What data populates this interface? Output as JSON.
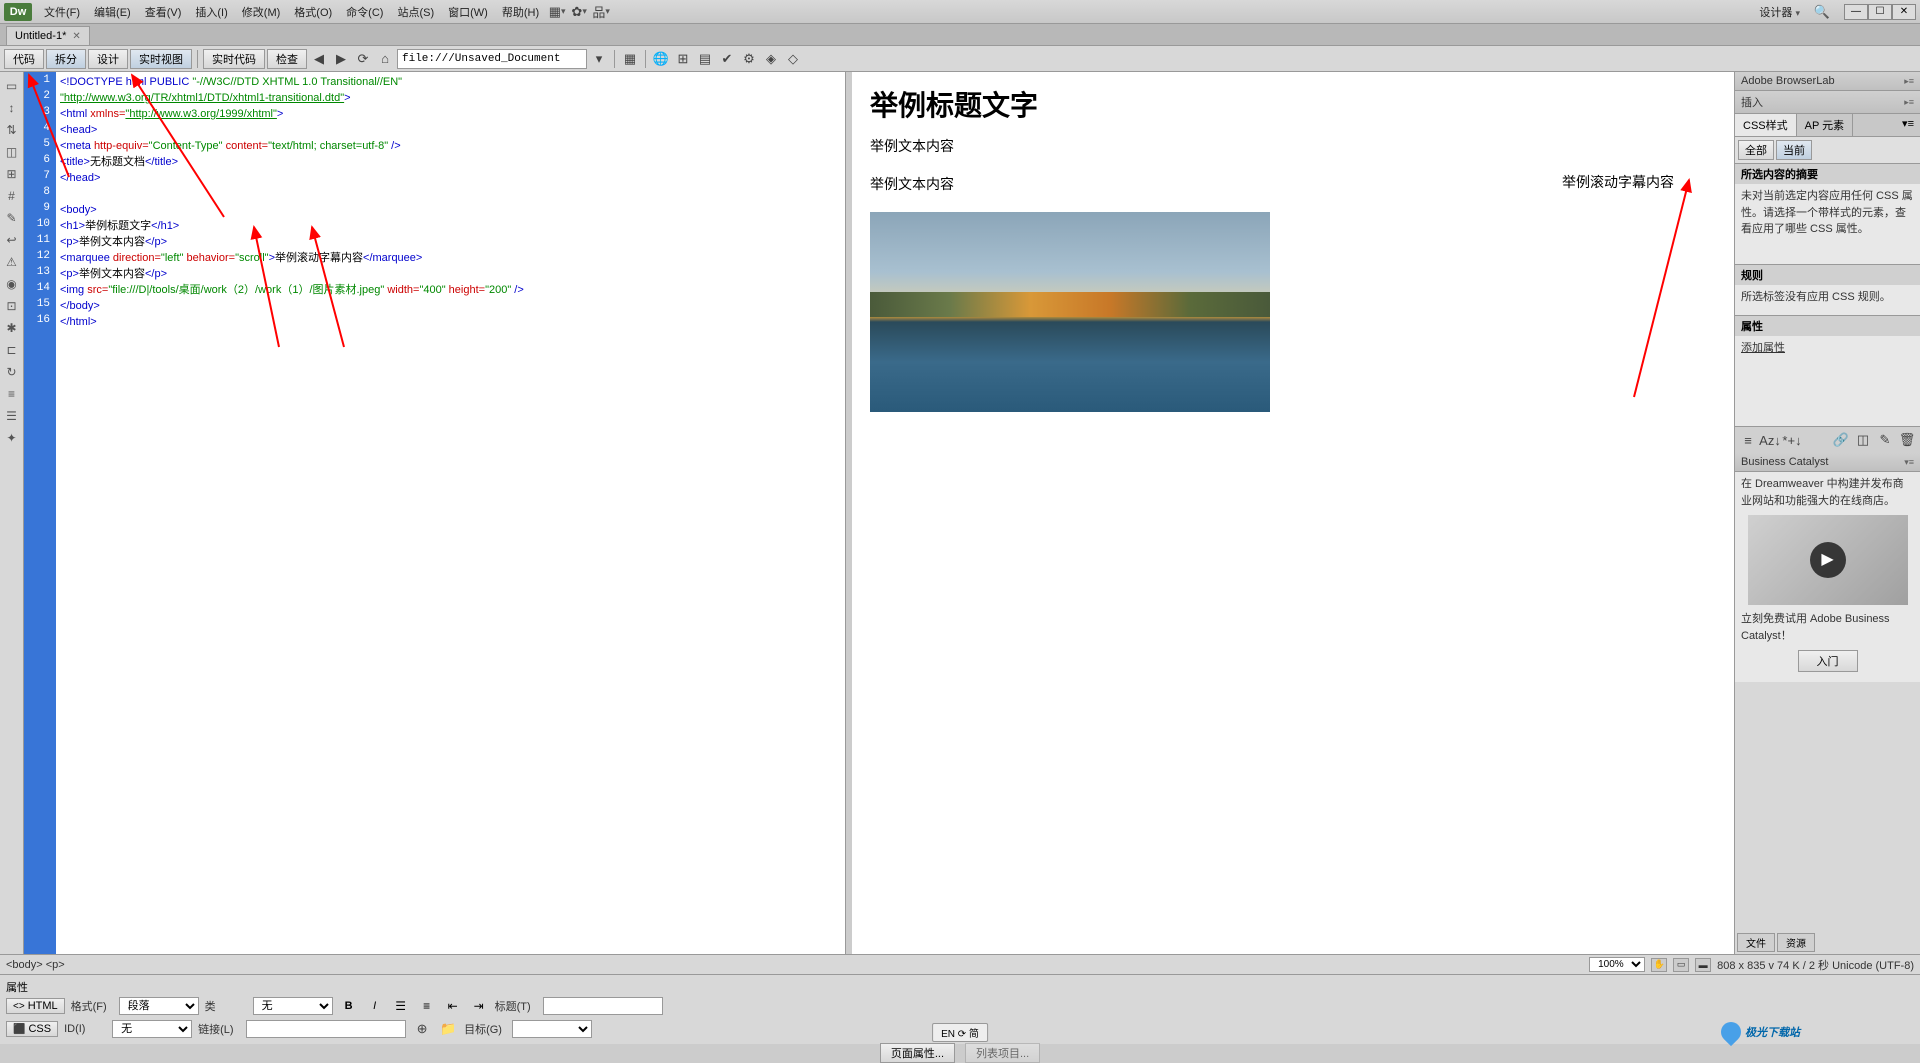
{
  "app": {
    "logo": "Dw",
    "designer": "设计器"
  },
  "menu": [
    "文件(F)",
    "编辑(E)",
    "查看(V)",
    "插入(I)",
    "修改(M)",
    "格式(O)",
    "命令(C)",
    "站点(S)",
    "窗口(W)",
    "帮助(H)"
  ],
  "doctab": {
    "name": "Untitled-1*"
  },
  "viewbar": {
    "code": "代码",
    "split": "拆分",
    "design": "设计",
    "live": "实时视图",
    "livecode": "实时代码",
    "inspect": "检查",
    "address": "file:///Unsaved_Document"
  },
  "code": {
    "lines": [
      "1",
      "2",
      "3",
      "4",
      "5",
      "6",
      "7",
      "8",
      "9",
      "10",
      "11",
      "12",
      "13",
      "14",
      "15",
      "16"
    ],
    "l1a": "<!DOCTYPE html PUBLIC ",
    "l1b": "\"-//W3C//DTD XHTML 1.0 Transitional//EN\"",
    "l2": "\"http://www.w3.org/TR/xhtml1/DTD/xhtml1-transitional.dtd\"",
    "l2b": ">",
    "l3a": "<html ",
    "l3b": "xmlns=",
    "l3c": "\"http://www.w3.org/1999/xhtml\"",
    "l3d": ">",
    "l4": "<head>",
    "l5a": "<meta ",
    "l5b": "http-equiv=",
    "l5c": "\"Content-Type\"",
    "l5d": " content=",
    "l5e": "\"text/html; charset=utf-8\"",
    "l5f": " />",
    "l6a": "<title>",
    "l6b": "无标题文档",
    "l6c": "</title>",
    "l7": "</head>",
    "l9": "<body>",
    "l10a": "<h1>",
    "l10b": "举例标题文字",
    "l10c": "</h1>",
    "l11a": "<p>",
    "l11b": "举例文本内容",
    "l11c": "</p>",
    "l12a": "<marquee ",
    "l12b": "direction=",
    "l12c": "\"left\"",
    "l12d": " behavior=",
    "l12e": "\"scroll\"",
    "l12f": ">",
    "l12g": "举例滚动字幕内容",
    "l12h": "</marquee>",
    "l13a": "<p>",
    "l13b": "举例文本内容",
    "l13c": "</p>",
    "l14a": "<img ",
    "l14b": "src=",
    "l14c": "\"file:///D|/tools/桌面/work（2）/work（1）/图片素材.jpeg\"",
    "l14d": " width=",
    "l14e": "\"400\"",
    "l14f": " height=",
    "l14g": "\"200\"",
    "l14h": " />",
    "l15": "</body>",
    "l16": "</html>"
  },
  "preview": {
    "h1": "举例标题文字",
    "p1": "举例文本内容",
    "marquee": "举例滚动字幕内容",
    "p2": "举例文本内容"
  },
  "rightpanel": {
    "browserlab": "Adobe BrowserLab",
    "insert": "插入",
    "css_tab": "CSS样式",
    "ap_tab": "AP 元素",
    "all": "全部",
    "current": "当前",
    "summary_title": "所选内容的摘要",
    "summary_text": "未对当前选定内容应用任何 CSS 属性。请选择一个带样式的元素，查看应用了哪些 CSS 属性。",
    "rules_title": "规则",
    "rules_text": "所选标签没有应用 CSS 规则。",
    "props_title": "属性",
    "add_prop": "添加属性",
    "bc_title": "Business Catalyst",
    "bc_text": "在 Dreamweaver 中构建并发布商业网站和功能强大的在线商店。",
    "bc_try": "立刻免费试用 Adobe Business Catalyst！",
    "intro": "入门",
    "file_tab": "文件",
    "res_tab": "资源"
  },
  "status": {
    "path": "<body> <p>",
    "zoom": "100%",
    "dims": "808 x 835 v  74 K / 2 秒 Unicode (UTF-8)"
  },
  "properties": {
    "title": "属性",
    "html_tab": "HTML",
    "css_tab": "CSS",
    "format_label": "格式(F)",
    "format_val": "段落",
    "id_label": "ID(I)",
    "id_val": "无",
    "class_label": "类",
    "class_val": "无",
    "link_label": "链接(L)",
    "title_label": "标题(T)",
    "target_label": "目标(G)",
    "page_props": "页面属性...",
    "list_item": "列表项目..."
  },
  "lang": "EN ⟳ 简",
  "watermark": "极光下载站"
}
